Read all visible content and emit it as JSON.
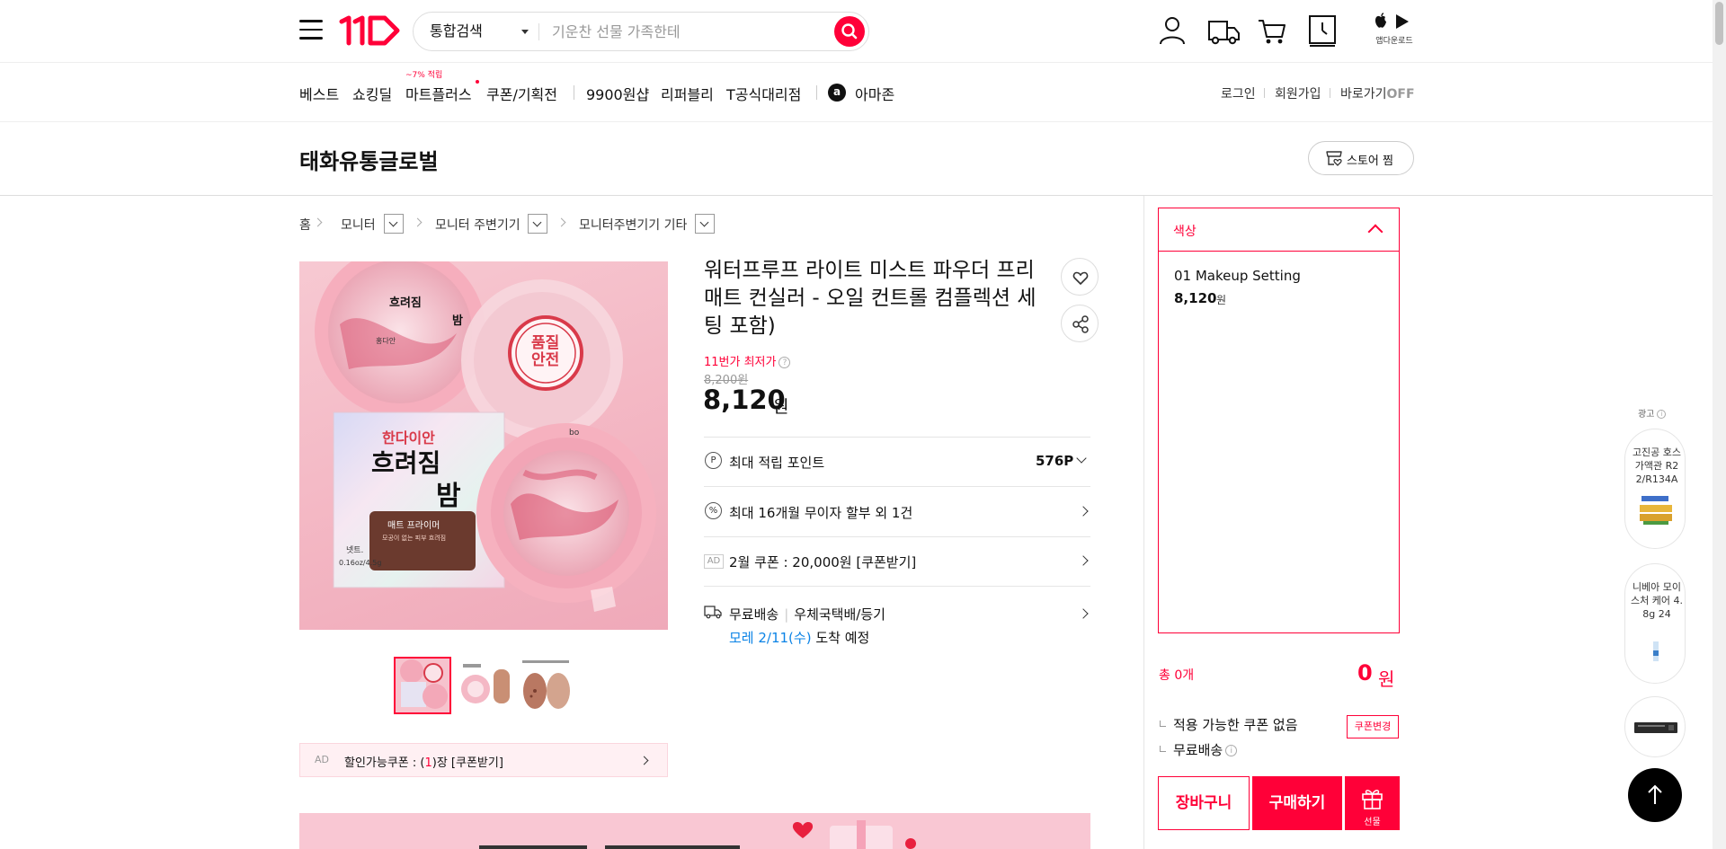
{
  "header": {
    "search_scope": "통합검색",
    "search_placeholder": "기운찬 선물 가족한테",
    "app_download_label": "앱다운로드"
  },
  "nav": {
    "items": [
      "베스트",
      "쇼킹딜",
      "마트플러스",
      "쿠폰/기획전",
      "9900원샵",
      "리퍼블리",
      "T공식대리점",
      "아마존"
    ],
    "mart_badge": "~7% 적립",
    "amazon_letter": "a",
    "util": {
      "login": "로그인",
      "signup": "회원가입",
      "shortcut": "바로가기",
      "shortcut_state": "OFF"
    }
  },
  "store": {
    "name": "태화유통글로벌",
    "fav_label": "스토어 찜"
  },
  "breadcrumb": [
    "홈",
    "모니터",
    "모니터 주변기기",
    "모니터주변기기 기타"
  ],
  "product": {
    "title": "워터프루프 라이트 미스트 파우더 프리 매트 컨실러 - 오일 컨트롤 컴플렉션 세팅 포함)",
    "lowest_label": "11번가 최저가",
    "lowest_info": "?",
    "original_price": "8,200원",
    "sale_price": "8,120",
    "sale_unit": "원",
    "image_texts": {
      "lid_title": "흐려짐",
      "lid_sub": "밤",
      "lid_brand": "홍다안",
      "stamp_line1": "품질",
      "stamp_line2": "안전",
      "box_brand": "한다이안",
      "box_title": "흐려짐",
      "box_sub": "밤",
      "box_tag": "매트 프라이머",
      "box_desc": "모공이 없는 피부 흐려짐",
      "box_weight_label": "넷트.",
      "box_weight": "0.16oz/4.5g",
      "back_text": "bo"
    },
    "rows": {
      "points_icon": "P",
      "points_label": "최대 적립 포인트",
      "points_value": "576P",
      "installment_icon": "%",
      "installment_label": "최대 16개월 무이자 할부 외 1건",
      "coupon_ad": "AD",
      "coupon_label": "2월 쿠폰 : 20,000원 [쿠폰받기]",
      "delivery_label": "무료배송",
      "delivery_method": "우체국택배/등기",
      "arrival_date": "모레 2/11(수)",
      "arrival_suffix": "도착 예정"
    },
    "discount_coupon": {
      "ad": "AD",
      "prefix": "할인가능쿠폰 : (",
      "count": "1",
      "suffix": ")장 [쿠폰받기]"
    }
  },
  "option_panel": {
    "header": "색상",
    "items": [
      {
        "name": "01 Makeup Setting",
        "price": "8,120",
        "unit": "원"
      }
    ],
    "total_label": "총 0개",
    "total_value": "0",
    "total_unit": "원",
    "coupon_status": "적용 가능한 쿠폰 없음",
    "coupon_change": "쿠폰변경",
    "shipping": "무료배송",
    "shipping_info": "i",
    "cart_label": "장바구니",
    "buy_label": "구매하기",
    "gift_label": "선물"
  },
  "side_ads": {
    "label": "광고",
    "label_icon": "i",
    "items": [
      {
        "title": "고진공 호스 가액관 R22/R134A"
      },
      {
        "title": "니베아 모이스처 케어 4.8g 24"
      }
    ]
  },
  "colors": {
    "brand": "#ff0038",
    "link_blue": "#0b83e6"
  }
}
